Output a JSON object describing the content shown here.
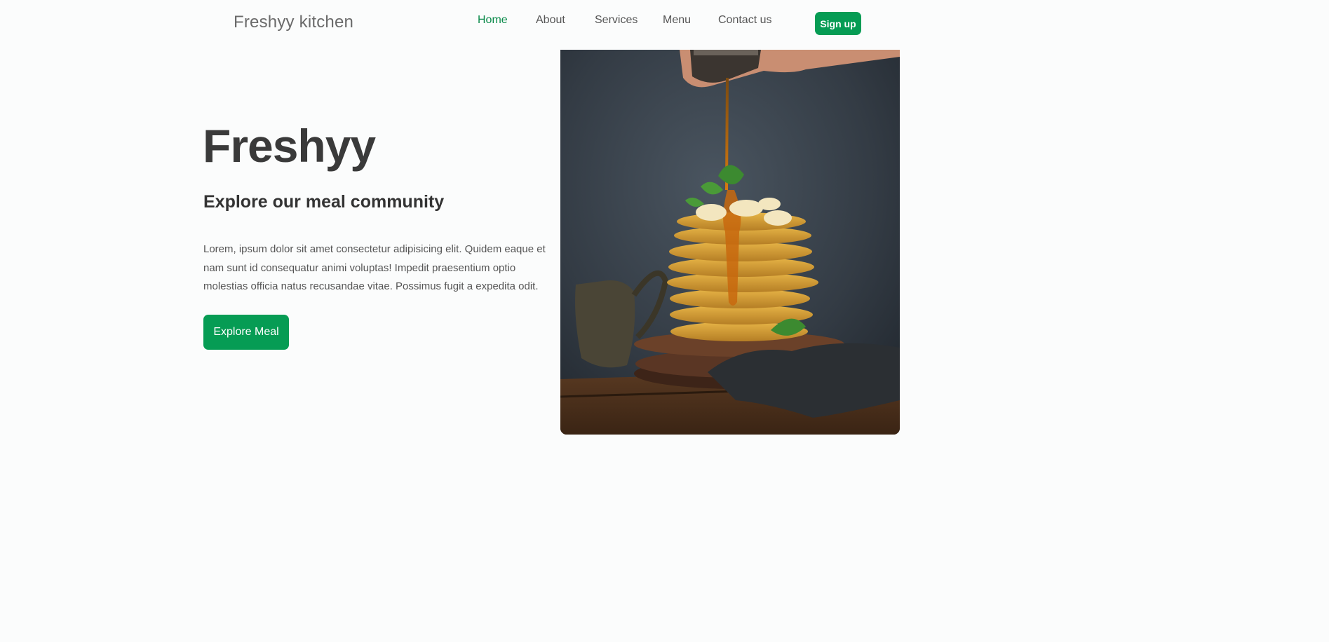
{
  "nav": {
    "brand": "Freshyy kitchen",
    "links": [
      {
        "label": "Home",
        "active": true
      },
      {
        "label": "About",
        "active": false
      },
      {
        "label": "Services",
        "active": false
      },
      {
        "label": "Menu",
        "active": false
      },
      {
        "label": "Contact us",
        "active": false
      }
    ],
    "signup_label": "Sign up"
  },
  "hero": {
    "title": "Freshyy",
    "subtitle": "Explore our meal community",
    "description": "Lorem, ipsum dolor sit amet consectetur adipisicing elit. Quidem eaque et nam sunt id consequatur animi voluptas! Impedit praesentium optio molestias officia natus recusandae vitae. Possimus fugit a expedita odit.",
    "cta_label": "Explore Meal",
    "image": "pancake-stack-with-syrup-photo"
  },
  "colors": {
    "accent": "#069c54",
    "active_link": "#0a8a4a",
    "background": "#fbfcfc",
    "heading": "#333333"
  }
}
